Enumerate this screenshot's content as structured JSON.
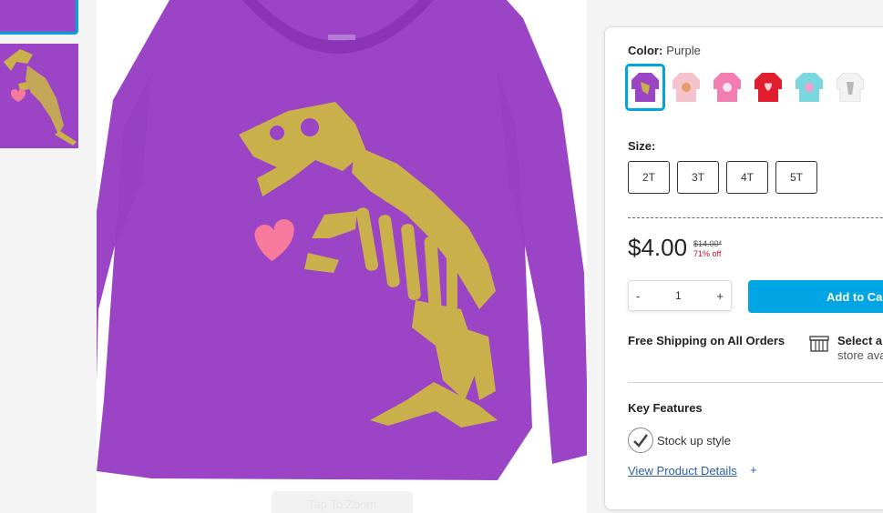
{
  "product": {
    "color_label": "Color:",
    "color_value": "Purple",
    "swatch_colors": [
      "#9b45c6",
      "#f4c3cc",
      "#f27eb1",
      "#e01e2d",
      "#7ad7e0",
      "#f2f2f2"
    ],
    "size_label": "Size:",
    "sizes": [
      "2T",
      "3T",
      "4T",
      "5T"
    ],
    "price": "$4.00",
    "original_price": "$14.00*",
    "discount": "71% off",
    "quantity": "1",
    "qty_minus": "-",
    "qty_plus": "+",
    "add_to_cart": "Add to Cart",
    "shipping": "Free Shipping on All Orders",
    "store_line1": "Select a store",
    "store_line2": "store availability",
    "key_features_title": "Key Features",
    "feature": "Stock up style",
    "details_link": "View Product Details",
    "details_plus": "+"
  },
  "image": {
    "zoom_label": "Tap To Zoom",
    "shirt_color": "#9b45c6",
    "print_color": "#c9b04a",
    "heart_color": "#f77a9d"
  }
}
